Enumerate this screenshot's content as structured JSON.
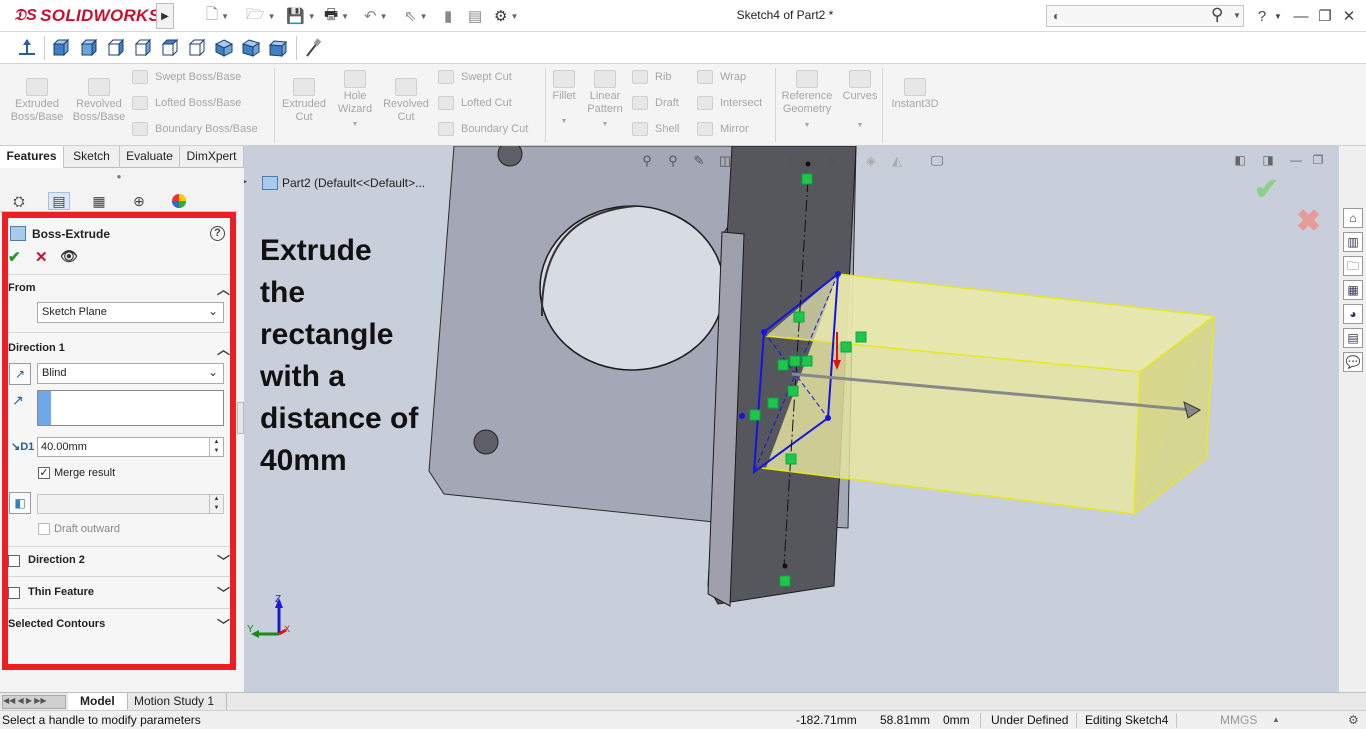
{
  "app": {
    "logo": "SOLIDWORKS",
    "document_title": "Sketch4 of Part2 *"
  },
  "search": {
    "placeholder": ""
  },
  "title_buttons": [
    "?",
    "—",
    "❐",
    "✕"
  ],
  "command_manager": {
    "features": [
      {
        "label": "Extruded Boss/Base"
      },
      {
        "label": "Revolved Boss/Base"
      },
      {
        "label": "Swept Boss/Base"
      },
      {
        "label": "Lofted Boss/Base"
      },
      {
        "label": "Boundary Boss/Base"
      },
      {
        "label": "Extruded Cut"
      },
      {
        "label": "Hole Wizard"
      },
      {
        "label": "Revolved Cut"
      },
      {
        "label": "Swept Cut"
      },
      {
        "label": "Lofted Cut"
      },
      {
        "label": "Boundary Cut"
      },
      {
        "label": "Fillet"
      },
      {
        "label": "Linear Pattern"
      },
      {
        "label": "Rib"
      },
      {
        "label": "Draft"
      },
      {
        "label": "Shell"
      },
      {
        "label": "Wrap"
      },
      {
        "label": "Intersect"
      },
      {
        "label": "Mirror"
      },
      {
        "label": "Reference Geometry"
      },
      {
        "label": "Curves"
      },
      {
        "label": "Instant3D"
      }
    ]
  },
  "tabs": [
    "Features",
    "Sketch",
    "Evaluate",
    "DimXpert"
  ],
  "property_manager": {
    "title": "Boss-Extrude",
    "from_section": "From",
    "from_value": "Sketch Plane",
    "direction1_section": "Direction 1",
    "end_condition": "Blind",
    "depth": "40.00mm",
    "merge_result": "Merge result",
    "draft_outward": "Draft outward",
    "direction2": "Direction 2",
    "thin_feature": "Thin Feature",
    "selected_contours": "Selected Contours"
  },
  "viewport": {
    "tree_item": "Part2  (Default<<Default>...",
    "annotation_lines": [
      "Extrude",
      "the",
      "rectangle",
      "with a",
      "distance of",
      "40mm"
    ],
    "axis_labels": {
      "x": "X",
      "y": "Y",
      "z": "Z"
    }
  },
  "bottom_tabs": [
    "Model",
    "Motion Study 1"
  ],
  "status": {
    "hint": "Select a handle to modify parameters",
    "x": "-182.71mm",
    "y": "58.81mm",
    "z": "0mm",
    "state": "Under Defined",
    "editing": "Editing Sketch4",
    "units": "MMGS"
  },
  "colors": {
    "brand": "#c8102e",
    "highlight_border": "#ee1c25",
    "viewport_bg": "#c9cfda",
    "extrude_preview": "#e6e6a0"
  }
}
